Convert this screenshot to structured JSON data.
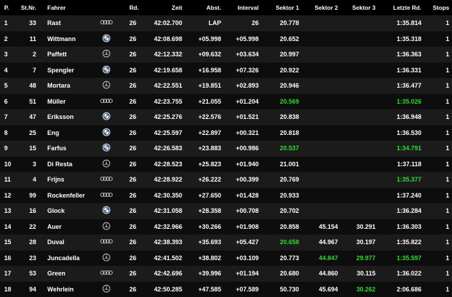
{
  "headers": {
    "pos": "P.",
    "num": "St.Nr.",
    "driver": "Fahrer",
    "laps": "Rd.",
    "time": "Zeit",
    "gap": "Abst.",
    "interval": "Interval",
    "s1": "Sektor 1",
    "s2": "Sektor 2",
    "s3": "Sektor 3",
    "last": "Letzte Rd.",
    "stops": "Stops"
  },
  "colors": {
    "best": "#33dd33",
    "text": "#ffffff",
    "row_odd": "#1b1b1b",
    "row_even": "#0d0d0d"
  },
  "rows": [
    {
      "pos": "1",
      "num": "33",
      "driver": "Rast",
      "brand": "audi-logo",
      "laps": "26",
      "time": "42:02.700",
      "gap": "LAP",
      "interval": "26",
      "s1": "20.778",
      "s1_best": false,
      "s2": "",
      "s2_best": false,
      "s3": "",
      "s3_best": false,
      "last": "1:35.814",
      "last_best": false,
      "stops": "1"
    },
    {
      "pos": "2",
      "num": "11",
      "driver": "Wittmann",
      "brand": "bmw-logo",
      "laps": "26",
      "time": "42:08.698",
      "gap": "+05.998",
      "interval": "+05.998",
      "s1": "20.652",
      "s1_best": false,
      "s2": "",
      "s2_best": false,
      "s3": "",
      "s3_best": false,
      "last": "1:35.318",
      "last_best": false,
      "stops": "1"
    },
    {
      "pos": "3",
      "num": "2",
      "driver": "Paffett",
      "brand": "mercedes-logo",
      "laps": "26",
      "time": "42:12.332",
      "gap": "+09.632",
      "interval": "+03.634",
      "s1": "20.997",
      "s1_best": false,
      "s2": "",
      "s2_best": false,
      "s3": "",
      "s3_best": false,
      "last": "1:36.363",
      "last_best": false,
      "stops": "1"
    },
    {
      "pos": "4",
      "num": "7",
      "driver": "Spengler",
      "brand": "bmw-logo",
      "laps": "26",
      "time": "42:19.658",
      "gap": "+16.958",
      "interval": "+07.326",
      "s1": "20.922",
      "s1_best": false,
      "s2": "",
      "s2_best": false,
      "s3": "",
      "s3_best": false,
      "last": "1:36.331",
      "last_best": false,
      "stops": "1"
    },
    {
      "pos": "5",
      "num": "48",
      "driver": "Mortara",
      "brand": "mercedes-logo",
      "laps": "26",
      "time": "42:22.551",
      "gap": "+19.851",
      "interval": "+02.893",
      "s1": "20.946",
      "s1_best": false,
      "s2": "",
      "s2_best": false,
      "s3": "",
      "s3_best": false,
      "last": "1:36.477",
      "last_best": false,
      "stops": "1"
    },
    {
      "pos": "6",
      "num": "51",
      "driver": "Müller",
      "brand": "audi-logo",
      "laps": "26",
      "time": "42:23.755",
      "gap": "+21.055",
      "interval": "+01.204",
      "s1": "20.569",
      "s1_best": true,
      "s2": "",
      "s2_best": false,
      "s3": "",
      "s3_best": false,
      "last": "1:35.026",
      "last_best": true,
      "stops": "1"
    },
    {
      "pos": "7",
      "num": "47",
      "driver": "Eriksson",
      "brand": "bmw-logo",
      "laps": "26",
      "time": "42:25.276",
      "gap": "+22.576",
      "interval": "+01.521",
      "s1": "20.838",
      "s1_best": false,
      "s2": "",
      "s2_best": false,
      "s3": "",
      "s3_best": false,
      "last": "1:36.948",
      "last_best": false,
      "stops": "1"
    },
    {
      "pos": "8",
      "num": "25",
      "driver": "Eng",
      "brand": "bmw-logo",
      "laps": "26",
      "time": "42:25.597",
      "gap": "+22.897",
      "interval": "+00.321",
      "s1": "20.818",
      "s1_best": false,
      "s2": "",
      "s2_best": false,
      "s3": "",
      "s3_best": false,
      "last": "1:36.530",
      "last_best": false,
      "stops": "1"
    },
    {
      "pos": "9",
      "num": "15",
      "driver": "Farfus",
      "brand": "bmw-logo",
      "laps": "26",
      "time": "42:26.583",
      "gap": "+23.883",
      "interval": "+00.986",
      "s1": "20.537",
      "s1_best": true,
      "s2": "",
      "s2_best": false,
      "s3": "",
      "s3_best": false,
      "last": "1:34.791",
      "last_best": true,
      "stops": "1"
    },
    {
      "pos": "10",
      "num": "3",
      "driver": "Di Resta",
      "brand": "mercedes-logo",
      "laps": "26",
      "time": "42:28.523",
      "gap": "+25.823",
      "interval": "+01.940",
      "s1": "21.001",
      "s1_best": false,
      "s2": "",
      "s2_best": false,
      "s3": "",
      "s3_best": false,
      "last": "1:37.118",
      "last_best": false,
      "stops": "1"
    },
    {
      "pos": "11",
      "num": "4",
      "driver": "Frijns",
      "brand": "audi-logo",
      "laps": "26",
      "time": "42:28.922",
      "gap": "+26.222",
      "interval": "+00.399",
      "s1": "20.769",
      "s1_best": false,
      "s2": "",
      "s2_best": false,
      "s3": "",
      "s3_best": false,
      "last": "1:35.377",
      "last_best": true,
      "stops": "1"
    },
    {
      "pos": "12",
      "num": "99",
      "driver": "Rockenfeller",
      "brand": "audi-logo",
      "laps": "26",
      "time": "42:30.350",
      "gap": "+27.650",
      "interval": "+01.428",
      "s1": "20.933",
      "s1_best": false,
      "s2": "",
      "s2_best": false,
      "s3": "",
      "s3_best": false,
      "last": "1:37.240",
      "last_best": false,
      "stops": "1"
    },
    {
      "pos": "13",
      "num": "16",
      "driver": "Glock",
      "brand": "bmw-logo",
      "laps": "26",
      "time": "42:31.058",
      "gap": "+28.358",
      "interval": "+00.708",
      "s1": "20.702",
      "s1_best": false,
      "s2": "",
      "s2_best": false,
      "s3": "",
      "s3_best": false,
      "last": "1:36.284",
      "last_best": false,
      "stops": "1"
    },
    {
      "pos": "14",
      "num": "22",
      "driver": "Auer",
      "brand": "mercedes-logo",
      "laps": "26",
      "time": "42:32.966",
      "gap": "+30.266",
      "interval": "+01.908",
      "s1": "20.858",
      "s1_best": false,
      "s2": "45.154",
      "s2_best": false,
      "s3": "30.291",
      "s3_best": false,
      "last": "1:36.303",
      "last_best": false,
      "stops": "1"
    },
    {
      "pos": "15",
      "num": "28",
      "driver": "Duval",
      "brand": "audi-logo",
      "laps": "26",
      "time": "42:38.393",
      "gap": "+35.693",
      "interval": "+05.427",
      "s1": "20.658",
      "s1_best": true,
      "s2": "44.967",
      "s2_best": false,
      "s3": "30.197",
      "s3_best": false,
      "last": "1:35.822",
      "last_best": false,
      "stops": "1"
    },
    {
      "pos": "16",
      "num": "23",
      "driver": "Juncadella",
      "brand": "mercedes-logo",
      "laps": "26",
      "time": "42:41.502",
      "gap": "+38.802",
      "interval": "+03.109",
      "s1": "20.773",
      "s1_best": false,
      "s2": "44.847",
      "s2_best": true,
      "s3": "29.977",
      "s3_best": true,
      "last": "1:35.597",
      "last_best": true,
      "stops": "1"
    },
    {
      "pos": "17",
      "num": "53",
      "driver": "Green",
      "brand": "audi-logo",
      "laps": "26",
      "time": "42:42.696",
      "gap": "+39.996",
      "interval": "+01.194",
      "s1": "20.680",
      "s1_best": false,
      "s2": "44.860",
      "s2_best": false,
      "s3": "30.115",
      "s3_best": false,
      "last": "1:36.022",
      "last_best": false,
      "stops": "1"
    },
    {
      "pos": "18",
      "num": "94",
      "driver": "Wehrlein",
      "brand": "mercedes-logo",
      "laps": "26",
      "time": "42:50.285",
      "gap": "+47.585",
      "interval": "+07.589",
      "s1": "50.730",
      "s1_best": false,
      "s2": "45.694",
      "s2_best": false,
      "s3": "30.262",
      "s3_best": true,
      "last": "2:06.686",
      "last_best": false,
      "stops": "1"
    }
  ]
}
